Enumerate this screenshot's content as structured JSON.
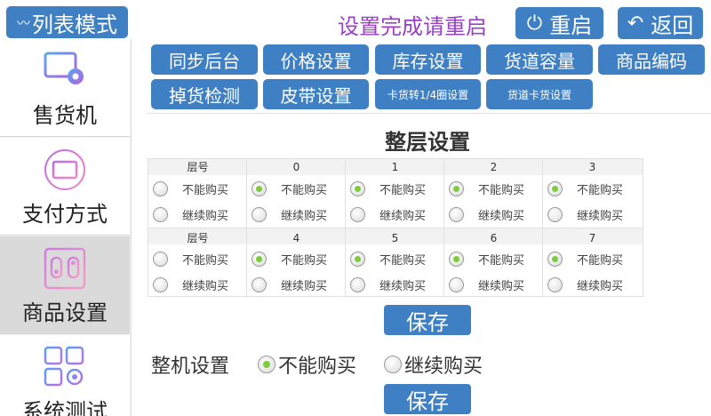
{
  "header": {
    "list_mode_label": "列表模式",
    "restart_notice": "设置完成请重启",
    "restart_label": "重启",
    "back_label": "返回"
  },
  "sidebar": {
    "items": [
      {
        "label": "售货机",
        "icon": "monitor-gear-icon",
        "active": false
      },
      {
        "label": "支付方式",
        "icon": "card-icon",
        "active": false
      },
      {
        "label": "商品设置",
        "icon": "product-slot-icon",
        "active": true
      },
      {
        "label": "系统测试",
        "icon": "grid-gear-icon",
        "active": false
      }
    ]
  },
  "tabs": {
    "row1": [
      "同步后台",
      "价格设置",
      "库存设置",
      "货道容量",
      "商品编码"
    ],
    "row2": [
      "掉货检测",
      "皮带设置",
      "卡货转1/4圈设置",
      "货道卡货设置"
    ],
    "active": "货道卡货设置"
  },
  "layer_setting": {
    "title": "整层设置",
    "layer_header": "层号",
    "option_no_buy": "不能购买",
    "option_continue_buy": "继续购买",
    "layers_row1": [
      "0",
      "1",
      "2",
      "3"
    ],
    "layers_row2": [
      "4",
      "5",
      "6",
      "7"
    ],
    "selected": "不能购买",
    "save_label": "保存"
  },
  "machine_setting": {
    "label": "整机设置",
    "option_no_buy": "不能购买",
    "option_continue_buy": "继续购买",
    "selected": "不能购买",
    "save_label": "保存"
  },
  "colors": {
    "button_blue": "#3f80c4",
    "active_tab": "#1f5a94",
    "notice_purple": "#9b3fc6",
    "radio_selected": "#7ccc3c"
  }
}
